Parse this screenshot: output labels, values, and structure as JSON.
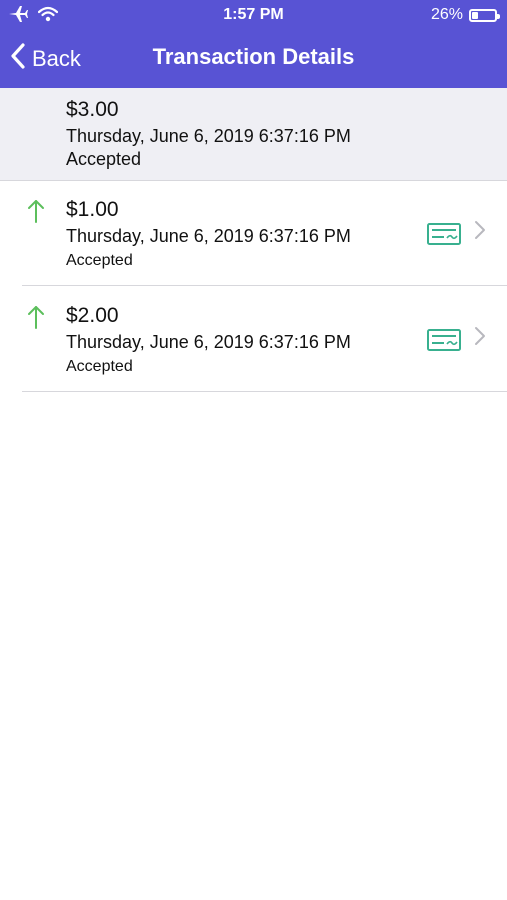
{
  "status_bar": {
    "time": "1:57 PM",
    "battery_percent": "26%",
    "battery_level": 0.26
  },
  "navbar": {
    "back_label": "Back",
    "title": "Transaction Details"
  },
  "summary": {
    "amount": "$3.00",
    "date": "Thursday, June 6, 2019 6:37:16 PM",
    "status": "Accepted"
  },
  "transactions": [
    {
      "amount": "$1.00",
      "date": "Thursday, June 6, 2019 6:37:16 PM",
      "status": "Accepted",
      "direction_icon": "arrow-up-icon",
      "type_icon": "check-icon"
    },
    {
      "amount": "$2.00",
      "date": "Thursday, June 6, 2019 6:37:16 PM",
      "status": "Accepted",
      "direction_icon": "arrow-up-icon",
      "type_icon": "check-icon"
    }
  ],
  "colors": {
    "nav_background": "#5853d4",
    "summary_background": "#efeff4",
    "arrow_green": "#5cbf5c",
    "check_teal": "#38b08f",
    "separator": "#d7d7dc"
  }
}
